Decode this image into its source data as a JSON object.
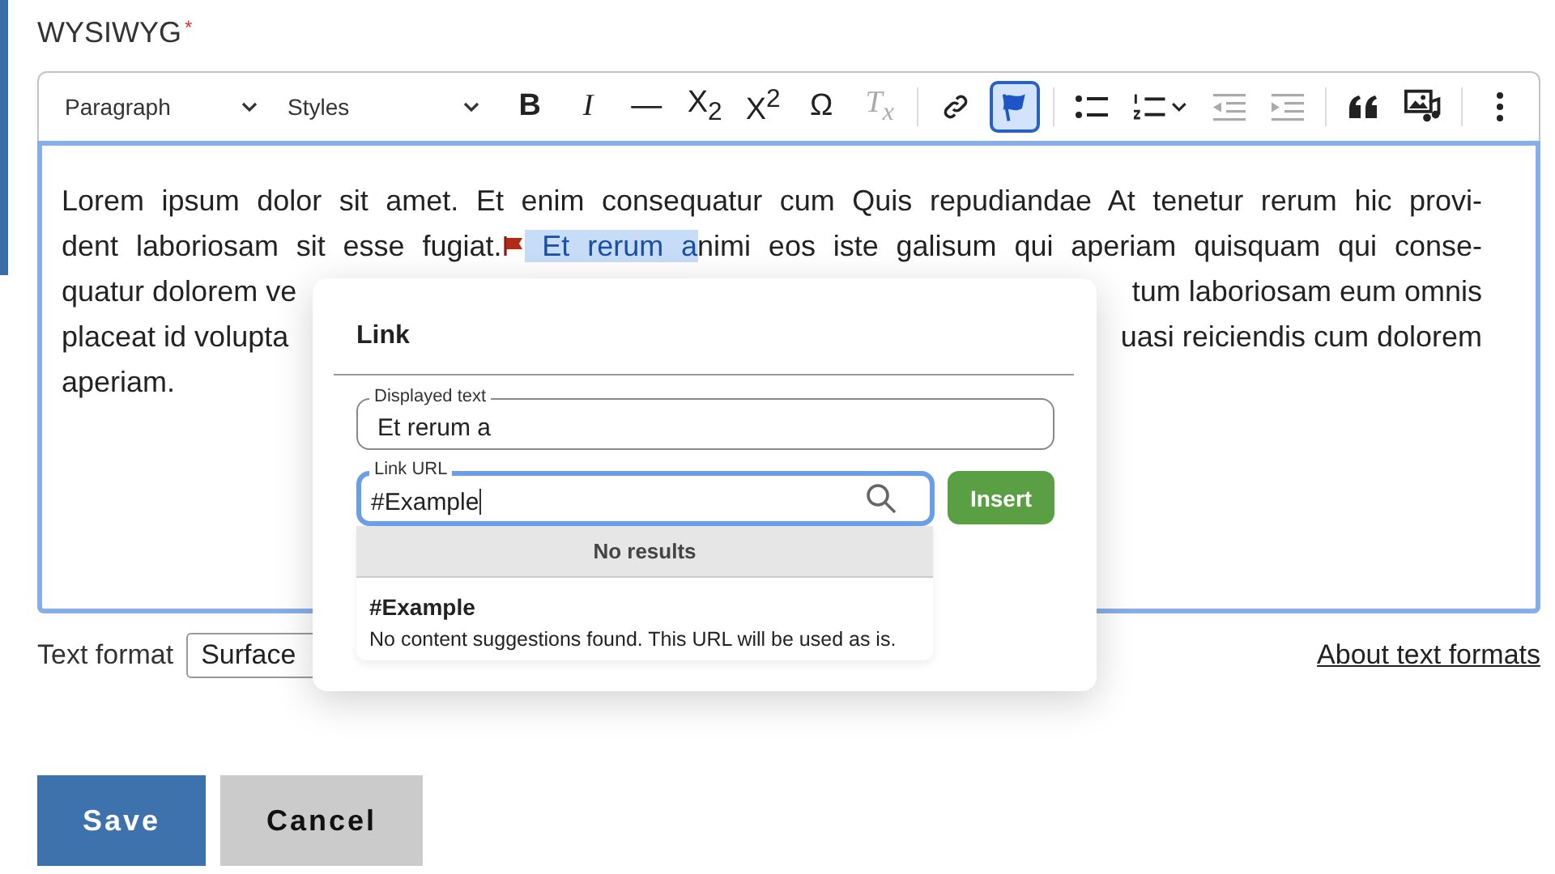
{
  "field": {
    "label": "WYSIWYG",
    "required_mark": "*"
  },
  "toolbar": [
    {
      "kind": "dropdown",
      "label": "Paragraph"
    },
    {
      "kind": "dropdown",
      "label": "Styles"
    },
    {
      "kind": "glyph",
      "label": "B",
      "on": false,
      "disabled": false
    },
    {
      "kind": "glyph",
      "label": "I",
      "on": false,
      "disabled": false
    },
    {
      "kind": "glyph",
      "label": "—",
      "on": false,
      "disabled": false
    },
    {
      "kind": "glyph",
      "label": "X$_{2}$",
      "on": false,
      "disabled": false
    },
    {
      "kind": "glyph",
      "label": "X$^{2}$",
      "on": false,
      "disabled": false
    },
    {
      "kind": "glyph",
      "label": "Ω",
      "on": false,
      "disabled": false
    },
    {
      "kind": "glyph",
      "label": "T$_{x}$",
      "on": false,
      "disabled": true
    },
    {
      "kind": "separator"
    },
    {
      "kind": "link",
      "on": false,
      "disabled": false
    },
    {
      "kind": "anchor",
      "on": true,
      "disabled": false
    },
    {
      "kind": "separator"
    },
    {
      "kind": "bulleted",
      "on": false,
      "disabled": false
    },
    {
      "kind": "numbered",
      "on": false,
      "disabled": false
    },
    {
      "kind": "outdent",
      "on": false,
      "disabled": true
    },
    {
      "kind": "indent",
      "on": false,
      "disabled": true
    },
    {
      "kind": "separator"
    },
    {
      "kind": "quote",
      "on": false,
      "disabled": false
    },
    {
      "kind": "media",
      "on": false,
      "disabled": false
    },
    {
      "kind": "separator"
    },
    {
      "kind": "more",
      "on": false,
      "disabled": false
    }
  ],
  "editor_lines": [
    {
      "kind": "full",
      "segments": [
        {
          "text": "Lorem ipsum dolor sit amet. Et enim consequatur cum Quis repudiandae At tenetur rerum hic provi-",
          "selected": false
        }
      ]
    },
    {
      "kind": "full",
      "segments": [
        {
          "text": "dent laboriosam sit esse fugiat.",
          "selected": false
        },
        {
          "kind": "anchor"
        },
        {
          "text": " Et rerum a",
          "selected": true
        },
        {
          "text": "nimi eos iste galisum qui aperiam quisquam qui conse-",
          "selected": false
        }
      ]
    },
    {
      "kind": "split",
      "left": "quatur dolorem ve",
      "right": "tum laboriosam eum omnis"
    },
    {
      "kind": "split",
      "left": "placeat id volupta",
      "right": "uasi reiciendis cum dolorem"
    },
    {
      "kind": "last",
      "segments": [
        {
          "text": "aperiam.",
          "selected": false
        }
      ]
    }
  ],
  "text_format": {
    "label": "Text format",
    "value": "Surface",
    "help_link": "About text formats"
  },
  "buttons": [
    {
      "label": "Save",
      "kind": "primary"
    },
    {
      "label": "Cancel",
      "kind": "secondary"
    }
  ],
  "link_dialog": {
    "title": "Link",
    "displayed_text": {
      "label": "Displayed text",
      "value": "Et rerum a",
      "focused": false
    },
    "link_url": {
      "label": "Link URL",
      "value": "#Example",
      "focused": true
    },
    "insert_button": "Insert",
    "results_header": "No results",
    "suggestion": {
      "title": "#Example",
      "description": "No content suggestions found. This URL will be used as is."
    }
  }
}
